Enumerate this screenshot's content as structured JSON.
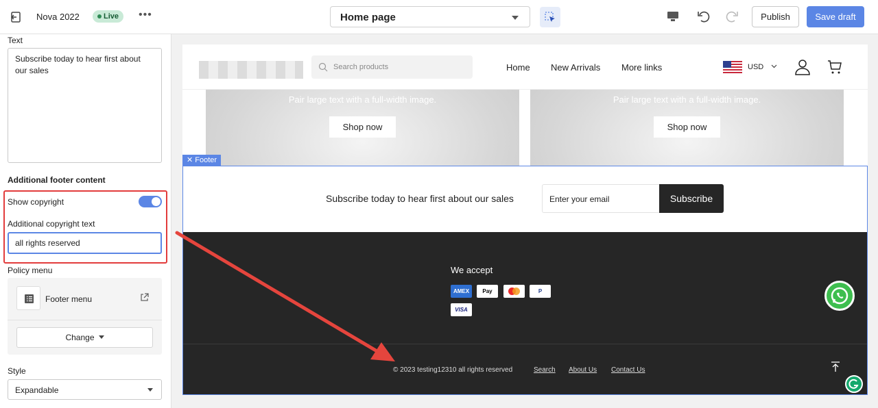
{
  "topbar": {
    "store_name": "Nova 2022",
    "live_badge": "Live",
    "more_label": "•••",
    "page_select": "Home page",
    "publish_label": "Publish",
    "save_label": "Save draft"
  },
  "sidebar": {
    "text_label": "Text",
    "text_value": "Subscribe today to hear first about our sales",
    "section_heading": "Additional footer content",
    "show_copyright_label": "Show copyright",
    "show_copyright_on": true,
    "copyright_text_label": "Additional copyright text",
    "copyright_text_value": "all rights reserved",
    "policy_menu_label": "Policy menu",
    "policy_menu_name": "Footer menu",
    "change_label": "Change",
    "style_label": "Style",
    "style_value": "Expandable"
  },
  "preview": {
    "header": {
      "search_placeholder": "Search products",
      "nav": [
        "Home",
        "New Arrivals",
        "More links"
      ],
      "currency": "USD"
    },
    "hero": {
      "text": "Pair large text with a full-width image.",
      "button": "Shop now"
    },
    "footer_tag": "Footer",
    "subscribe": {
      "text": "Subscribe today to hear first about our sales",
      "email_placeholder": "Enter your email",
      "button": "Subscribe"
    },
    "we_accept": "We accept",
    "payment_cards": [
      "AMEX",
      "Apple Pay",
      "Mastercard",
      "PayPal",
      "VISA"
    ],
    "copyright": "© 2023 testing12310 all rights reserved",
    "footer_links": [
      "Search",
      "About Us",
      "Contact Us"
    ]
  },
  "colors": {
    "accent": "#5b86e5",
    "annotation": "#e23b3b",
    "footer_dark": "#262626"
  }
}
